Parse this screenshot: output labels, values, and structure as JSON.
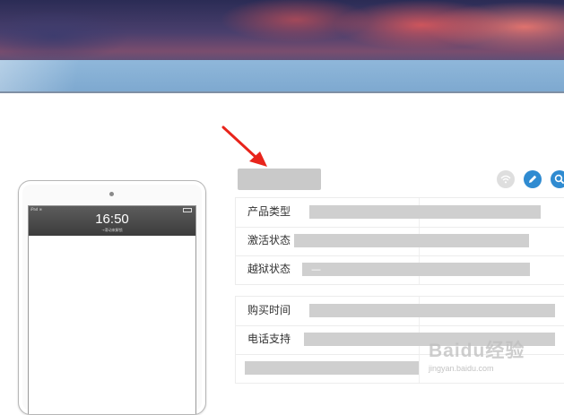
{
  "device": {
    "clock": "16:50",
    "status_left": "iPad ≋",
    "slide_text": "→滑动来解锁"
  },
  "info_panel": {
    "rows_top": [
      {
        "label": "产品类型"
      },
      {
        "label": "激活状态"
      },
      {
        "label": "越狱状态"
      }
    ],
    "rows_bottom": [
      {
        "label": "购买时间"
      },
      {
        "label": "电话支持"
      },
      {
        "label": ""
      }
    ],
    "jailbreak_dash": "—"
  },
  "toolbar": {
    "icons": [
      "wifi-icon",
      "edit-icon",
      "search-icon"
    ]
  },
  "watermark": {
    "brand": "Baidu经验",
    "url": "jingyan.baidu.com"
  },
  "colors": {
    "accent": "#2f8bd1",
    "arrow": "#e8241b",
    "banner_band": "#8fb7da"
  }
}
